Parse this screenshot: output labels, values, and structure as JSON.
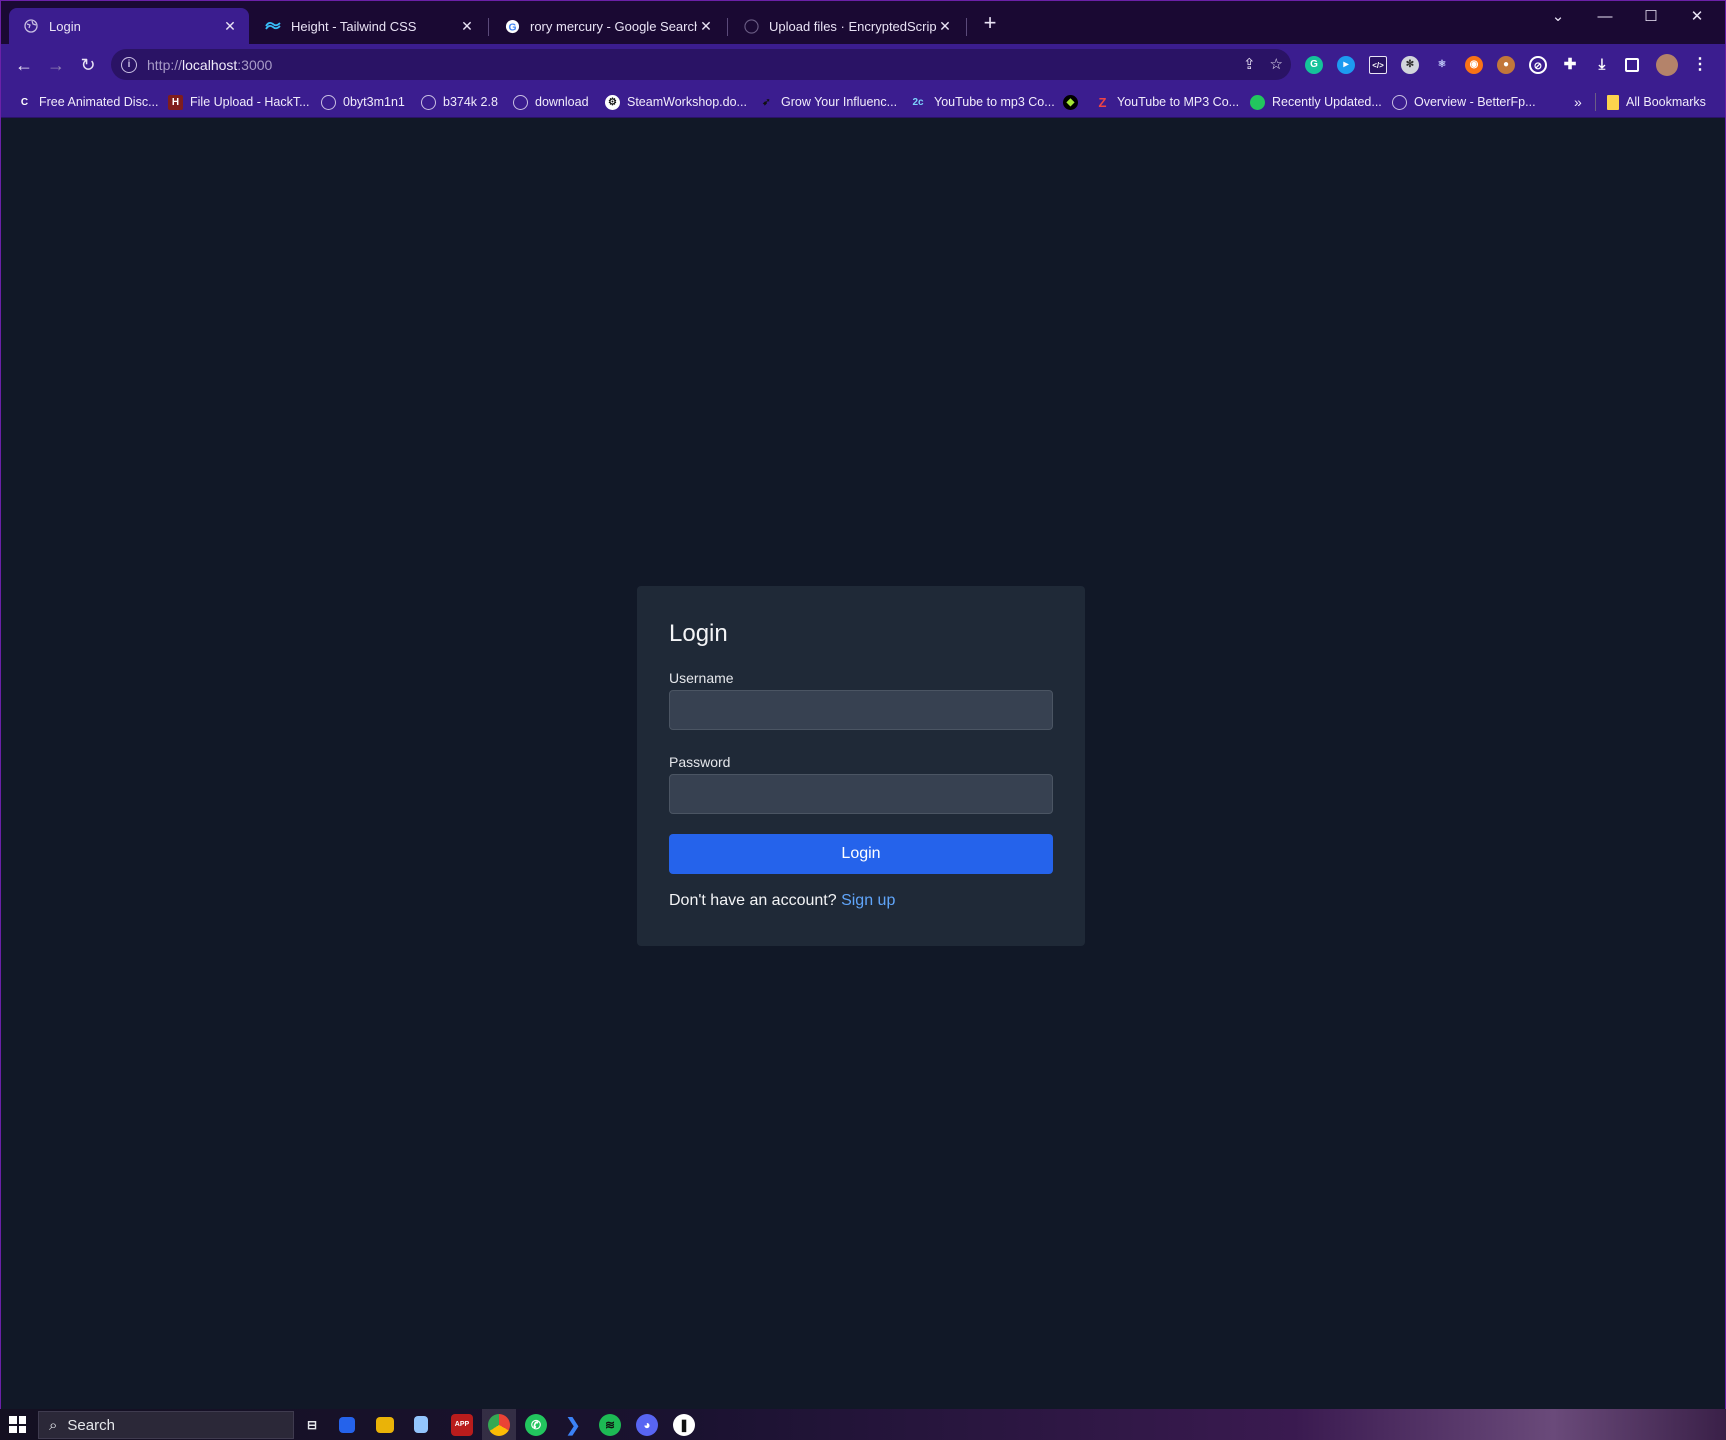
{
  "browser": {
    "tabs": [
      {
        "title": "Login",
        "icon": "globe-icon",
        "active": true
      },
      {
        "title": "Height - Tailwind CSS",
        "icon": "tailwind-icon",
        "active": false
      },
      {
        "title": "rory mercury - Google Search",
        "icon": "google-icon",
        "active": false
      },
      {
        "title": "Upload files · EncryptedScripts/s",
        "icon": "github-icon",
        "active": false
      }
    ],
    "address": {
      "scheme": "http://",
      "host": "localhost",
      "port": ":3000"
    },
    "bookmarks": [
      {
        "label": "Free Animated Disc...",
        "icon": "c-icon"
      },
      {
        "label": "File Upload - HackT...",
        "icon": "hacktricks-icon"
      },
      {
        "label": "0byt3m1n1",
        "icon": "globe-icon"
      },
      {
        "label": "b374k 2.8",
        "icon": "globe-icon"
      },
      {
        "label": "download",
        "icon": "globe-icon"
      },
      {
        "label": "SteamWorkshop.do...",
        "icon": "steam-icon"
      },
      {
        "label": "Grow Your Influenc...",
        "icon": "bird-icon"
      },
      {
        "label": "YouTube to mp3 Co...",
        "icon": "2c-icon"
      },
      {
        "label": "",
        "icon": "diamond-icon"
      },
      {
        "label": "YouTube to MP3 Co...",
        "icon": "z-icon"
      },
      {
        "label": "Recently Updated...",
        "icon": "earth-icon"
      },
      {
        "label": "Overview - BetterFp...",
        "icon": "globe-icon"
      }
    ],
    "all_bookmarks": "All Bookmarks",
    "overflow": "»"
  },
  "login": {
    "title": "Login",
    "username_label": "Username",
    "username_value": "",
    "password_label": "Password",
    "password_value": "",
    "submit_label": "Login",
    "signup_prompt": "Don't have an account?",
    "signup_link": "Sign up"
  },
  "taskbar": {
    "search_text": "Search"
  },
  "colors": {
    "page_bg": "#111827",
    "card_bg": "#1f2937",
    "input_bg": "#374151",
    "button_bg": "#2563eb",
    "link": "#60a5fa",
    "browser_frame": "#3b1d8f"
  }
}
